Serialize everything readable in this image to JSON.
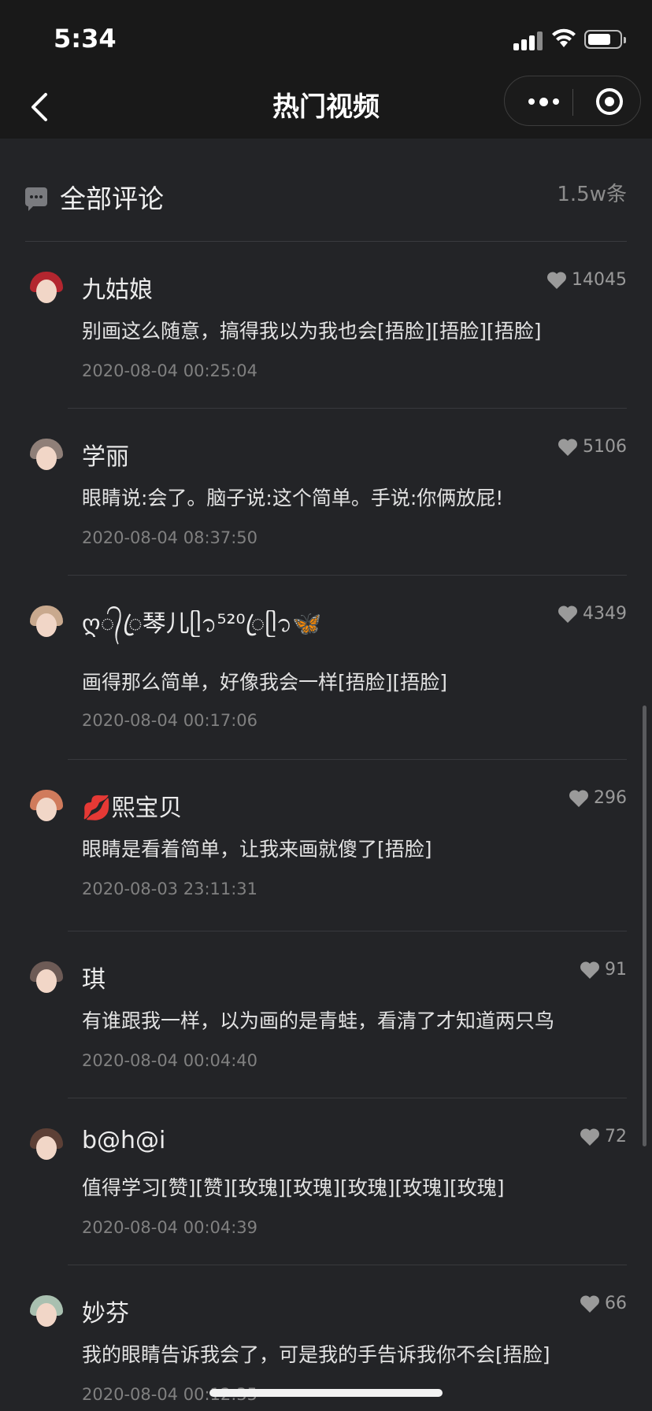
{
  "status": {
    "time": "5:34"
  },
  "nav": {
    "title": "热门视频"
  },
  "header": {
    "title": "全部评论",
    "count": "1.5w条"
  },
  "comments": [
    {
      "name": "九姑娘",
      "likes": "14045",
      "text": "别画这么随意，搞得我以为我也会[捂脸][捂脸][捂脸]",
      "date": "2020-08-04 00:25:04",
      "avatar_color": "#b3262f"
    },
    {
      "name": "学丽",
      "likes": "5106",
      "text": "眼睛说:会了。脑子说:这个简单。手说:你俩放屁!",
      "date": "2020-08-04 08:37:50",
      "avatar_color": "#8f7f78"
    },
    {
      "name": "ღ᭄ꦿ琴儿ᥫ᭡⁵²⁰ꦿᥫ᭡🦋",
      "likes": "4349",
      "text": "画得那么简单，好像我会一样[捂脸][捂脸]",
      "date": "2020-08-04 00:17:06",
      "avatar_color": "#c9a98e"
    },
    {
      "name": "💋熙宝贝",
      "likes": "296",
      "text": "眼睛是看着简单，让我来画就傻了[捂脸]",
      "date": "2020-08-03 23:11:31",
      "avatar_color": "#d07b5c"
    },
    {
      "name": "琪",
      "likes": "91",
      "text": "有谁跟我一样，以为画的是青蛙，看清了才知道两只鸟",
      "date": "2020-08-04 00:04:40",
      "avatar_color": "#6d5b56"
    },
    {
      "name": "b@h@i",
      "likes": "72",
      "text": "值得学习[赞][赞][玫瑰][玫瑰][玫瑰][玫瑰][玫瑰]",
      "date": "2020-08-04 00:04:39",
      "avatar_color": "#5d4036"
    },
    {
      "name": "妙芬",
      "likes": "66",
      "text": "我的眼睛告诉我会了，可是我的手告诉我你不会[捂脸]",
      "date": "2020-08-04 00:12:35",
      "avatar_color": "#a9c0b0"
    }
  ]
}
